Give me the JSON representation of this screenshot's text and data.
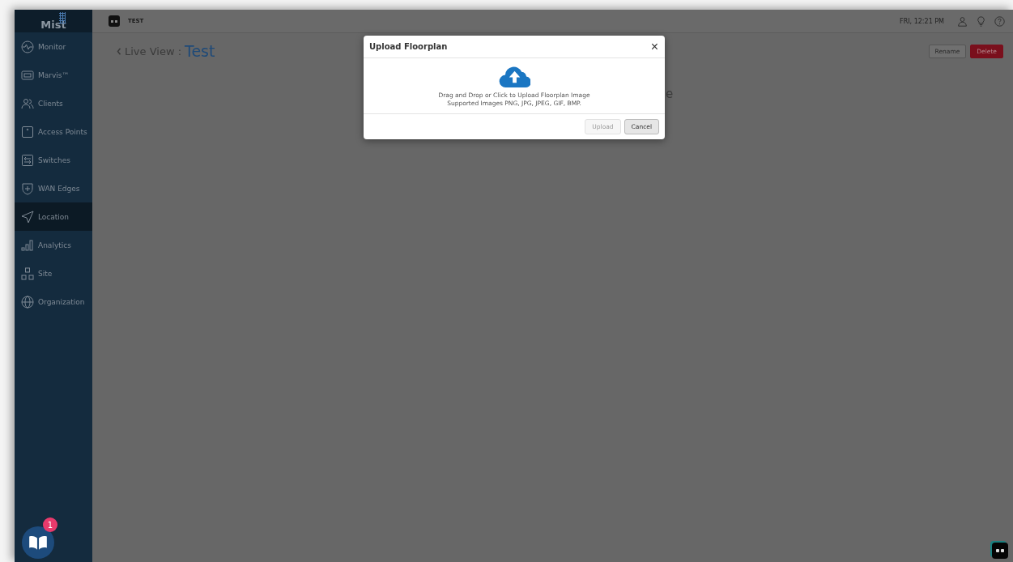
{
  "sidebar": {
    "logo": "Mist",
    "items": [
      {
        "label": "Monitor",
        "selected": false
      },
      {
        "label": "Marvis™",
        "selected": false
      },
      {
        "label": "Clients",
        "selected": false
      },
      {
        "label": "Access Points",
        "selected": false
      },
      {
        "label": "Switches",
        "selected": false
      },
      {
        "label": "WAN Edges",
        "selected": false
      },
      {
        "label": "Location",
        "selected": true
      },
      {
        "label": "Analytics",
        "selected": false
      },
      {
        "label": "Site",
        "selected": false
      },
      {
        "label": "Organization",
        "selected": false
      }
    ],
    "help_badge": "1"
  },
  "top_bar": {
    "site": "TEST",
    "datetime": "FRI, 12:21 PM"
  },
  "page": {
    "back_label": "Live View :",
    "title": "Test",
    "hidden_text": "e",
    "buttons": [
      "Rename",
      "Delete"
    ]
  },
  "modal": {
    "title": "Upload Floorplan",
    "close": "×",
    "lines": [
      "Drag and Drop or Click to Upload Floorplan Image",
      "Supported Images PNG, JPG, JPEG, GIF, BMP."
    ],
    "buttons": [
      {
        "label": "Upload",
        "disabled": true
      },
      {
        "label": "Cancel",
        "disabled": false
      }
    ]
  }
}
